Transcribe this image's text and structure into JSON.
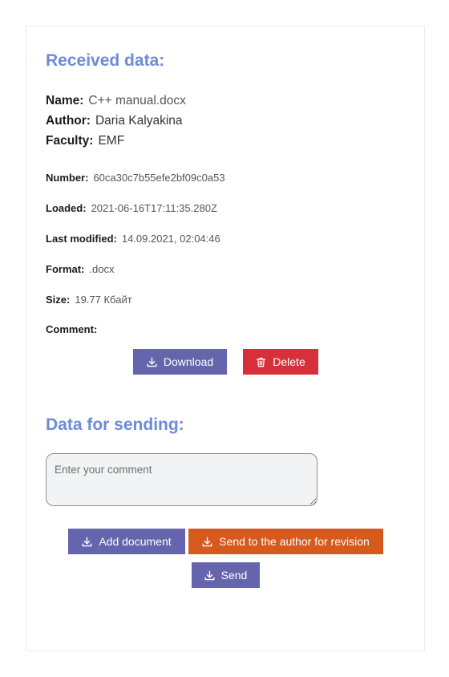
{
  "received": {
    "title": "Received data:",
    "name_label": "Name:",
    "name_value": "C++ manual.docx",
    "author_label": "Author:",
    "author_value": "Daria Kalyakina",
    "faculty_label": "Faculty:",
    "faculty_value": "EMF",
    "number_label": "Number:",
    "number_value": "60ca30c7b55efe2bf09c0a53",
    "loaded_label": "Loaded:",
    "loaded_value": "2021-06-16T17:11:35.280Z",
    "modified_label": "Last modified:",
    "modified_value": "14.09.2021, 02:04:46",
    "format_label": "Format:",
    "format_value": ".docx",
    "size_label": "Size:",
    "size_value": "19.77 Кбайт",
    "comment_label": "Comment:",
    "comment_value": "",
    "download_label": "Download",
    "delete_label": "Delete"
  },
  "sending": {
    "title": "Data for sending:",
    "comment_placeholder": "Enter your comment",
    "comment_value": "",
    "add_document_label": "Add document",
    "send_to_author_label": "Send to the author for revision",
    "send_label": "Send"
  },
  "colors": {
    "heading": "#6d8bd8",
    "primary_button": "#6565ad",
    "danger_button": "#d8303a",
    "warning_button": "#d65a1d"
  },
  "icons": {
    "download": "download-icon",
    "delete": "trash-icon"
  }
}
